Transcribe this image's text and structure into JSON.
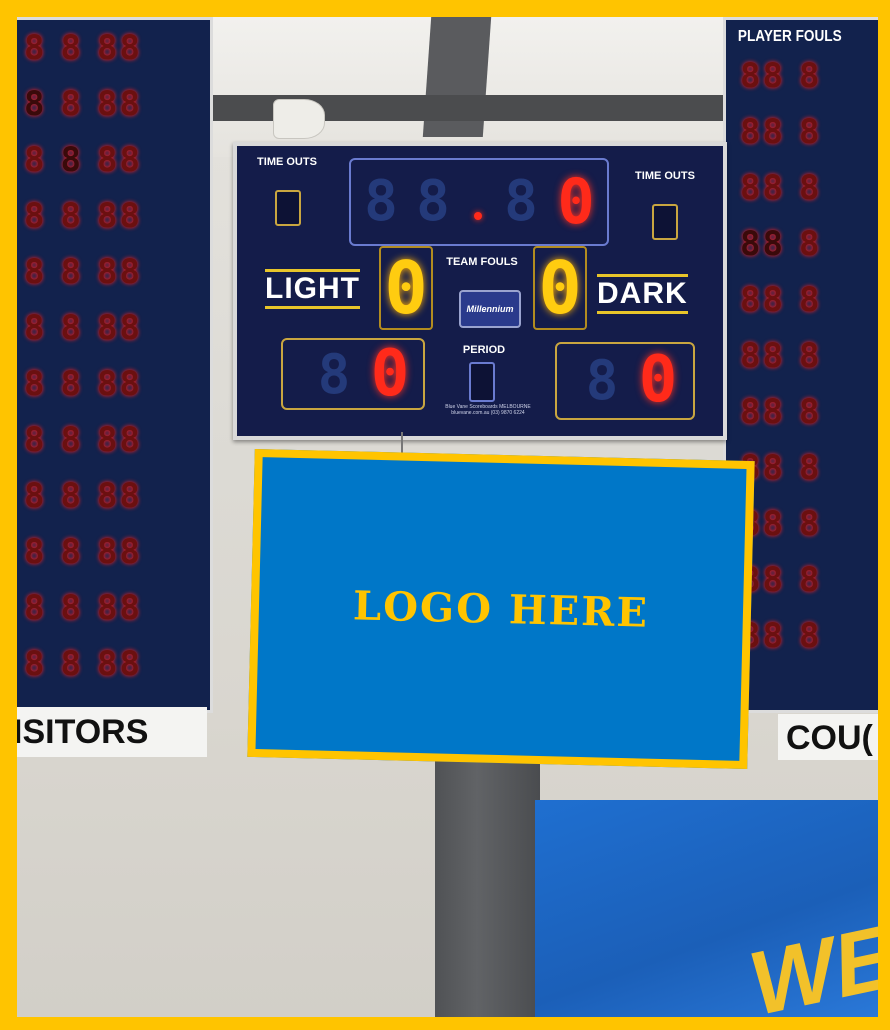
{
  "scoreboard": {
    "time_outs_left_label": "TIME OUTS",
    "time_outs_right_label": "TIME OUTS",
    "team_fouls_label": "TEAM FOULS",
    "period_label": "PERIOD",
    "home_team": "LIGHT",
    "away_team": "DARK",
    "clock_digit": "0",
    "light_fouls": "0",
    "dark_fouls": "0",
    "light_score": "0",
    "dark_score": "0",
    "brand": "Millennium",
    "brand_sub": "Blue Vane Scoreboards",
    "fine_print": "Blue Vane Scoreboards  MELBOURNE  bluevane.com.au  (03) 9870 6224"
  },
  "side_boards": {
    "left_label": "ISITORS",
    "right_label": "COU(",
    "right_header": "PLAYER  FOULS"
  },
  "logo_panel": {
    "text": "LOGO HERE"
  },
  "banner": {
    "text": "WE"
  },
  "colors": {
    "frame": "#ffc400",
    "logo_bg": "#0077c8",
    "board_bg": "#141c4a",
    "led_red": "#ff2a1a",
    "led_yellow": "#ffcc10"
  }
}
